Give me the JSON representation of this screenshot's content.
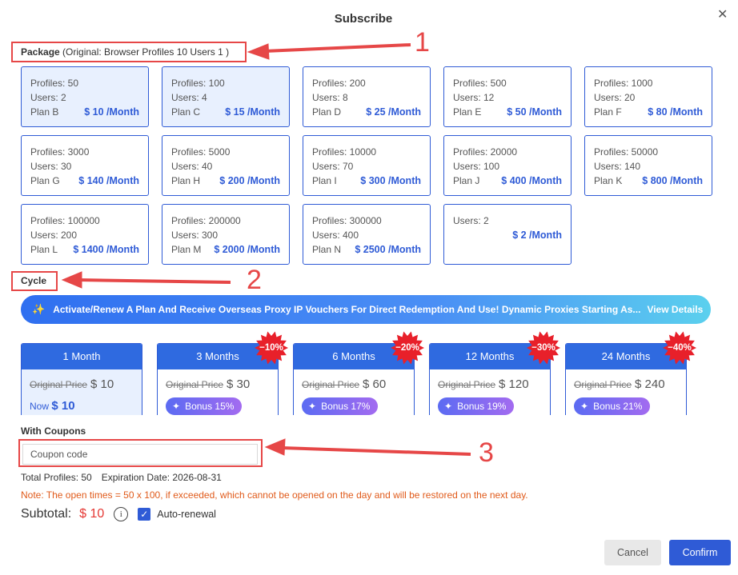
{
  "dialog": {
    "title": "Subscribe"
  },
  "package_section": {
    "label": "Package",
    "original": "(Original: Browser Profiles 10 Users 1 )"
  },
  "packages": [
    {
      "profiles": "Profiles: 50",
      "users": "Users: 2",
      "plan": "Plan B",
      "price": "$ 10 /Month",
      "selected": true
    },
    {
      "profiles": "Profiles: 100",
      "users": "Users: 4",
      "plan": "Plan C",
      "price": "$ 15 /Month",
      "selected": true
    },
    {
      "profiles": "Profiles: 200",
      "users": "Users: 8",
      "plan": "Plan D",
      "price": "$ 25 /Month"
    },
    {
      "profiles": "Profiles: 500",
      "users": "Users: 12",
      "plan": "Plan E",
      "price": "$ 50 /Month"
    },
    {
      "profiles": "Profiles: 1000",
      "users": "Users: 20",
      "plan": "Plan F",
      "price": "$ 80 /Month"
    },
    {
      "profiles": "Profiles: 3000",
      "users": "Users: 30",
      "plan": "Plan G",
      "price": "$ 140 /Month"
    },
    {
      "profiles": "Profiles: 5000",
      "users": "Users: 40",
      "plan": "Plan H",
      "price": "$ 200 /Month"
    },
    {
      "profiles": "Profiles: 10000",
      "users": "Users: 70",
      "plan": "Plan I",
      "price": "$ 300 /Month"
    },
    {
      "profiles": "Profiles: 20000",
      "users": "Users: 100",
      "plan": "Plan J",
      "price": "$ 400 /Month"
    },
    {
      "profiles": "Profiles: 50000",
      "users": "Users: 140",
      "plan": "Plan K",
      "price": "$ 800 /Month"
    },
    {
      "profiles": "Profiles: 100000",
      "users": "Users: 200",
      "plan": "Plan L",
      "price": "$ 1400 /Month"
    },
    {
      "profiles": "Profiles: 200000",
      "users": "Users: 300",
      "plan": "Plan M",
      "price": "$ 2000 /Month"
    },
    {
      "profiles": "Profiles: 300000",
      "users": "Users: 400",
      "plan": "Plan N",
      "price": "$ 2500 /Month"
    },
    {
      "profiles": "",
      "users": "Users: 2",
      "plan": "",
      "price": "$ 2 /Month"
    }
  ],
  "cycle_section": {
    "label": "Cycle"
  },
  "banner": {
    "text": "Activate/Renew A Plan And Receive Overseas Proxy IP Vouchers For Direct Redemption And Use! Dynamic Proxies Starting As...",
    "link": "View Details"
  },
  "cycles": [
    {
      "label": "1 Month",
      "original_label": "Original Price",
      "original_price": "$ 10",
      "now_label": "Now",
      "now_price": "$ 10",
      "selected": true
    },
    {
      "label": "3 Months",
      "original_label": "Original Price",
      "original_price": "$ 30",
      "discount": "−10%",
      "bonus": "Bonus 15%"
    },
    {
      "label": "6 Months",
      "original_label": "Original Price",
      "original_price": "$ 60",
      "discount": "−20%",
      "bonus": "Bonus 17%"
    },
    {
      "label": "12 Months",
      "original_label": "Original Price",
      "original_price": "$ 120",
      "discount": "−30%",
      "bonus": "Bonus 19%"
    },
    {
      "label": "24 Months",
      "original_label": "Original Price",
      "original_price": "$ 240",
      "discount": "−40%",
      "bonus": "Bonus 21%"
    }
  ],
  "coupons": {
    "label": "With Coupons",
    "placeholder": "Coupon code"
  },
  "summary": {
    "total_profiles": "Total Profiles: 50",
    "expiration": "Expiration Date: 2026-08-31",
    "note": "Note: The open times = 50 x 100, if exceeded, which cannot be opened on the day and will be restored on the next day.",
    "subtotal_label": "Subtotal:",
    "subtotal_value": "$ 10",
    "auto_renewal_label": "Auto-renewal",
    "auto_renewal_checked": true
  },
  "buttons": {
    "cancel": "Cancel",
    "confirm": "Confirm"
  },
  "annotations": [
    "1",
    "2",
    "3"
  ],
  "colors": {
    "accent": "#2f5bd6",
    "annotation": "#e64747",
    "badge": "#e8202a",
    "note": "#e05a1a"
  }
}
